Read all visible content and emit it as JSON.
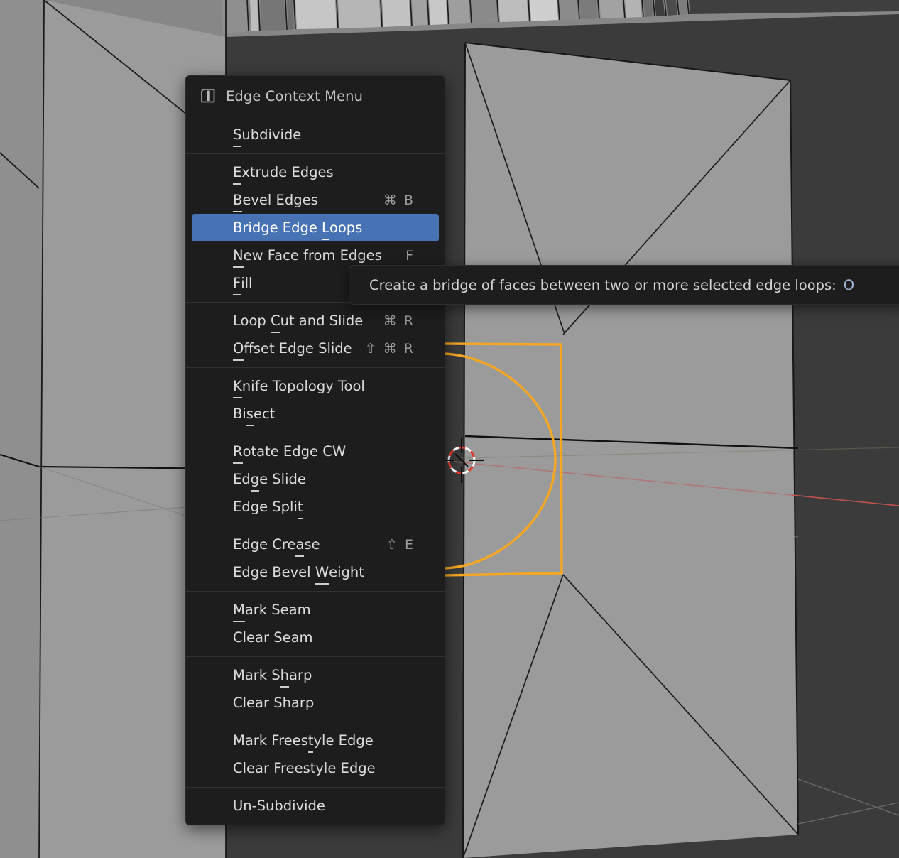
{
  "app": {
    "name": "Blender 3D Viewport",
    "mode": "Edit Mode",
    "select_mode": "edge"
  },
  "viewport": {
    "background_color": "#3b3b3b",
    "surface_color": "#9a9a9a",
    "surface_shadow_color": "#8e8e8e",
    "wire_color": "#151515",
    "selected_edge_color": "#f5a623",
    "axis_x_color": "#c44b4b",
    "cursor_label": "3d-cursor"
  },
  "context_menu": {
    "title": "Edge Context Menu",
    "icon": "edge-select-mode-icon",
    "highlight_color": "#4772b3",
    "sections": [
      {
        "items": [
          {
            "label": "Subdivide",
            "acc_index": 0,
            "shortcut": ""
          }
        ]
      },
      {
        "items": [
          {
            "label": "Extrude Edges",
            "acc_index": 0,
            "shortcut": ""
          },
          {
            "label": "Bevel Edges",
            "acc_index": 0,
            "shortcut": "⌘ B"
          },
          {
            "label": "Bridge Edge Loops",
            "acc_index": 12,
            "shortcut": "",
            "selected": true
          },
          {
            "label": "New Face from Edges",
            "acc_index": 0,
            "shortcut": "F"
          },
          {
            "label": "Fill",
            "acc_index": 0,
            "shortcut": ""
          }
        ]
      },
      {
        "items": [
          {
            "label": "Loop Cut and Slide",
            "acc_index": 5,
            "shortcut": "⌘ R"
          },
          {
            "label": "Offset Edge Slide",
            "acc_index": 0,
            "shortcut": "⇧ ⌘ R"
          }
        ]
      },
      {
        "items": [
          {
            "label": "Knife Topology Tool",
            "acc_index": 0,
            "shortcut": ""
          },
          {
            "label": "Bisect",
            "acc_index": 2,
            "shortcut": ""
          }
        ]
      },
      {
        "items": [
          {
            "label": "Rotate Edge CW",
            "acc_index": 0,
            "shortcut": ""
          },
          {
            "label": "Edge Slide",
            "acc_index": 2,
            "shortcut": ""
          },
          {
            "label": "Edge Split",
            "acc_index": 9,
            "shortcut": ""
          }
        ]
      },
      {
        "items": [
          {
            "label": "Edge Crease",
            "acc_index": 8,
            "shortcut": "⇧ E"
          },
          {
            "label": "Edge Bevel Weight",
            "acc_index": 11,
            "shortcut": ""
          }
        ]
      },
      {
        "items": [
          {
            "label": "Mark Seam",
            "acc_index": 0,
            "shortcut": ""
          },
          {
            "label": "Clear Seam",
            "acc_index": -1,
            "shortcut": ""
          }
        ]
      },
      {
        "items": [
          {
            "label": "Mark Sharp",
            "acc_index": 6,
            "shortcut": ""
          },
          {
            "label": "Clear Sharp",
            "acc_index": -1,
            "shortcut": ""
          }
        ]
      },
      {
        "items": [
          {
            "label": "Mark Freestyle Edge",
            "acc_index": 10,
            "shortcut": ""
          },
          {
            "label": "Clear Freestyle Edge",
            "acc_index": -1,
            "shortcut": ""
          }
        ]
      },
      {
        "items": [
          {
            "label": "Un-Subdivide",
            "acc_index": -1,
            "shortcut": ""
          }
        ]
      }
    ]
  },
  "tooltip": {
    "text": "Create a bridge of faces between two or more selected edge loops:",
    "value": "O"
  }
}
